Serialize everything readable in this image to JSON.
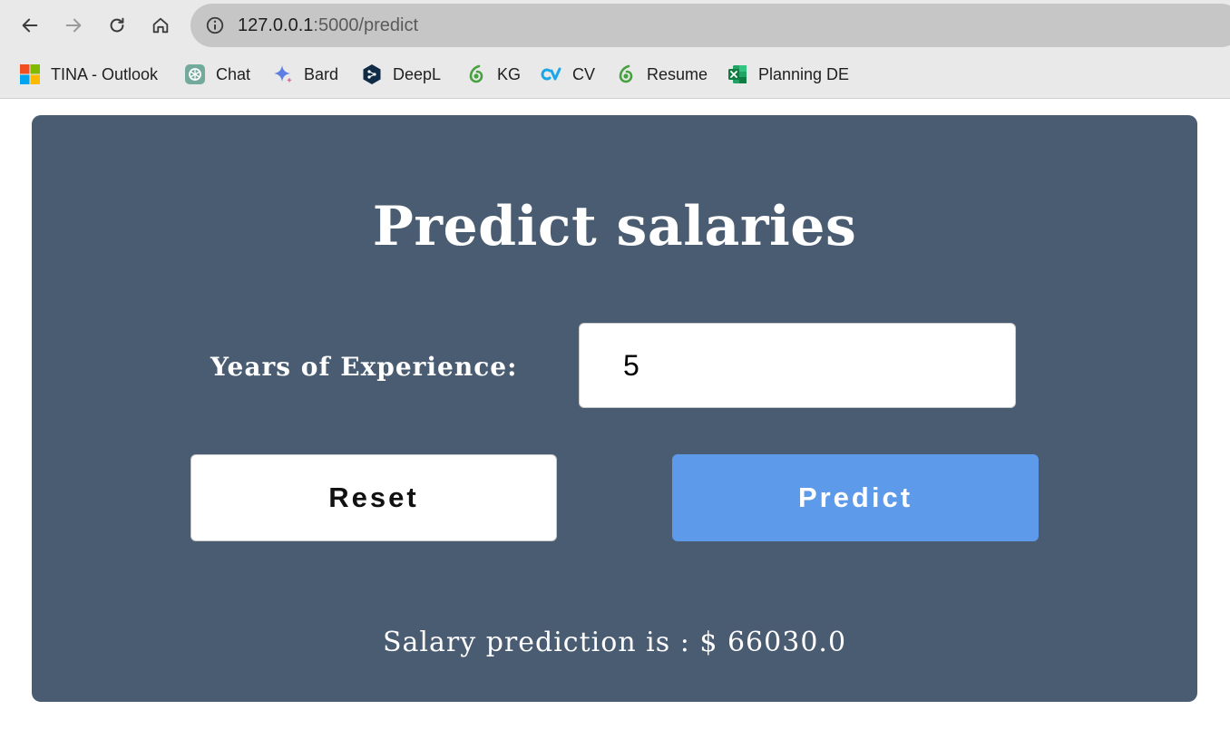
{
  "browser": {
    "url_host": "127.0.0.1",
    "url_path": ":5000/predict",
    "bookmarks": [
      {
        "label": "TINA - Outlook",
        "icon": "microsoft-icon"
      },
      {
        "label": "Chat",
        "icon": "chatgpt-icon"
      },
      {
        "label": "Bard",
        "icon": "bard-sparkle-icon"
      },
      {
        "label": "DeepL",
        "icon": "deepl-icon"
      },
      {
        "label": "KG",
        "icon": "overleaf-icon"
      },
      {
        "label": "CV",
        "icon": "cv-icon"
      },
      {
        "label": "Resume",
        "icon": "overleaf-icon"
      },
      {
        "label": "Planning DE",
        "icon": "excel-icon"
      }
    ]
  },
  "page": {
    "title": "Predict salaries",
    "field_label": "Years of Experience:",
    "years_value": "5",
    "reset_label": "Reset",
    "predict_label": "Predict",
    "result_text": "Salary prediction is : $ 66030.0"
  },
  "colors": {
    "card_bg": "#4a5c72",
    "predict_button": "#5e9aea"
  }
}
